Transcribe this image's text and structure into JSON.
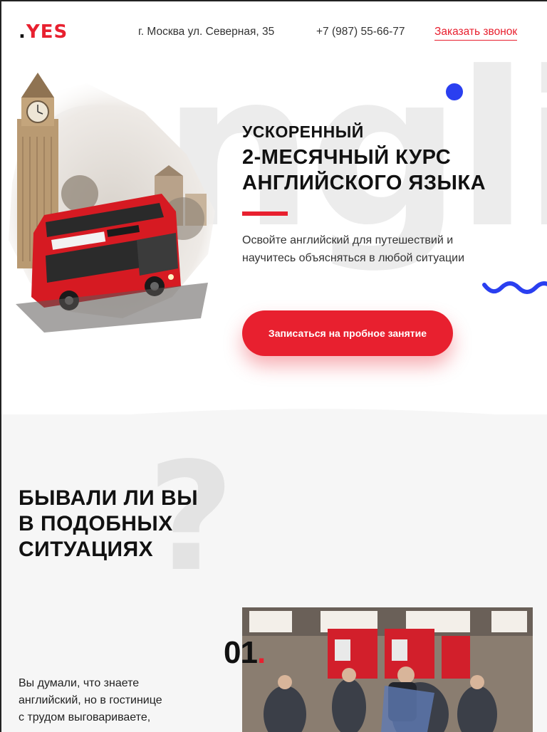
{
  "header": {
    "logo_dot": ".",
    "logo_text": "YES",
    "address": "г. Москва ул. Северная, 35",
    "phone": "+7 (987) 55-66-77",
    "callback_label": "Заказать звонок"
  },
  "hero": {
    "background_word": "english",
    "kicker": "Ускоренный",
    "title_line1": "2-месячный курс",
    "title_line2": "английского языка",
    "subtitle_line1": "Освойте английский для путешествий и",
    "subtitle_line2": "научитесь объясняться в любой ситуации",
    "cta_label": "Записаться на пробное занятие"
  },
  "section2": {
    "bg_symbol": "?",
    "title_line1": "Бывали ли вы",
    "title_line2": "в подобных",
    "title_line3": "ситуациях",
    "item_number": "01",
    "item_number_dot": ".",
    "item_text_line1": "Вы думали, что знаете",
    "item_text_line2": "английский, но в гостинице",
    "item_text_line3": "с трудом выговариваете,"
  },
  "colors": {
    "accent": "#e8202f",
    "blue": "#2a3ff0",
    "section_bg": "#f6f6f6"
  }
}
